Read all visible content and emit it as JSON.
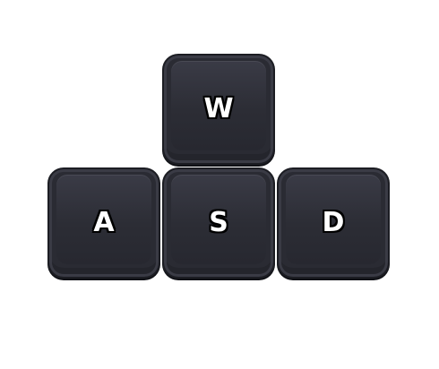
{
  "keys": {
    "w": {
      "label": "W"
    },
    "a": {
      "label": "A"
    },
    "s": {
      "label": "S"
    },
    "d": {
      "label": "D"
    }
  },
  "colors": {
    "background": "#ffffff",
    "key_face": "#2a2b33",
    "key_label": "#ffffff",
    "key_label_outline": "#000000"
  }
}
